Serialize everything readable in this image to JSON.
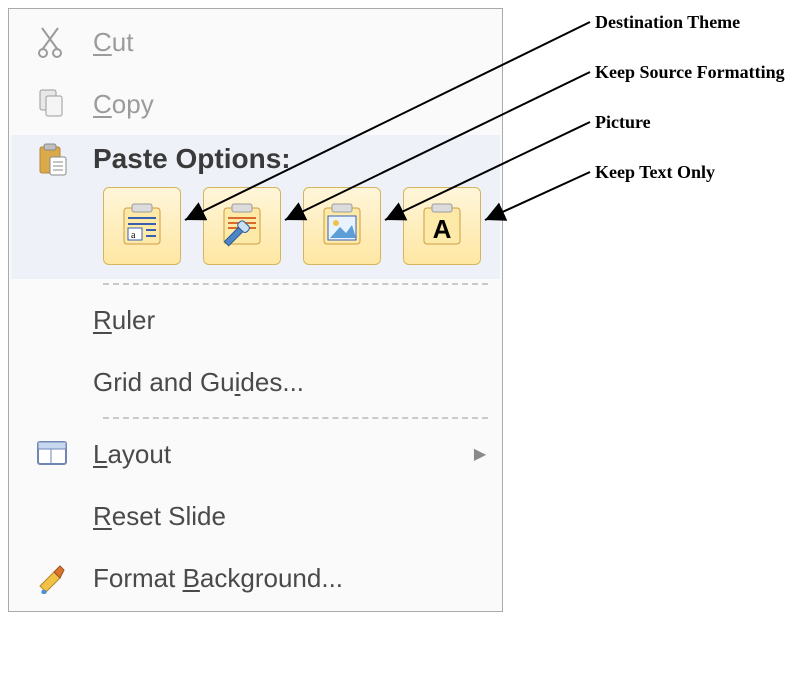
{
  "menu": {
    "cut": "Cut",
    "copy": "Copy",
    "paste_options_label": "Paste Options:",
    "paste_buttons": {
      "destination_theme": "Use Destination Theme",
      "keep_source_formatting": "Keep Source Formatting",
      "picture": "Picture",
      "keep_text_only": "Keep Text Only"
    },
    "ruler": "Ruler",
    "grid_guides": "Grid and Guides...",
    "layout": "Layout",
    "reset_slide": "Reset Slide",
    "format_background": "Format Background..."
  },
  "annotations": {
    "destination_theme": "Destination Theme",
    "keep_source_formatting": "Keep Source Formatting",
    "picture": "Picture",
    "keep_text_only": "Keep Text Only"
  }
}
